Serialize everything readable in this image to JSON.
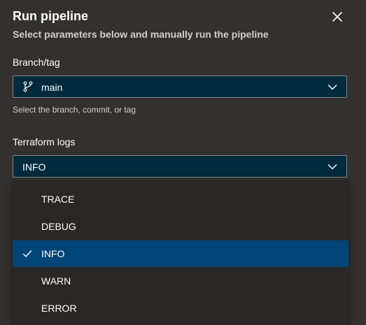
{
  "dialog": {
    "title": "Run pipeline",
    "subtitle": "Select parameters below and manually run the pipeline"
  },
  "branch": {
    "label": "Branch/tag",
    "value": "main",
    "helper": "Select the branch, commit, or tag"
  },
  "terraform_logs": {
    "label": "Terraform logs",
    "value": "INFO",
    "options": [
      {
        "label": "TRACE",
        "selected": false
      },
      {
        "label": "DEBUG",
        "selected": false
      },
      {
        "label": "INFO",
        "selected": true
      },
      {
        "label": "WARN",
        "selected": false
      },
      {
        "label": "ERROR",
        "selected": false
      }
    ]
  },
  "icons": {
    "close": "close-icon",
    "branch": "branch-icon",
    "chevron": "chevron-down-icon",
    "check": "checkmark-icon"
  },
  "colors": {
    "panel_bg": "#323130",
    "input_bg": "#002b3d",
    "selected_bg": "#004578",
    "dropdown_bg": "#292827"
  }
}
